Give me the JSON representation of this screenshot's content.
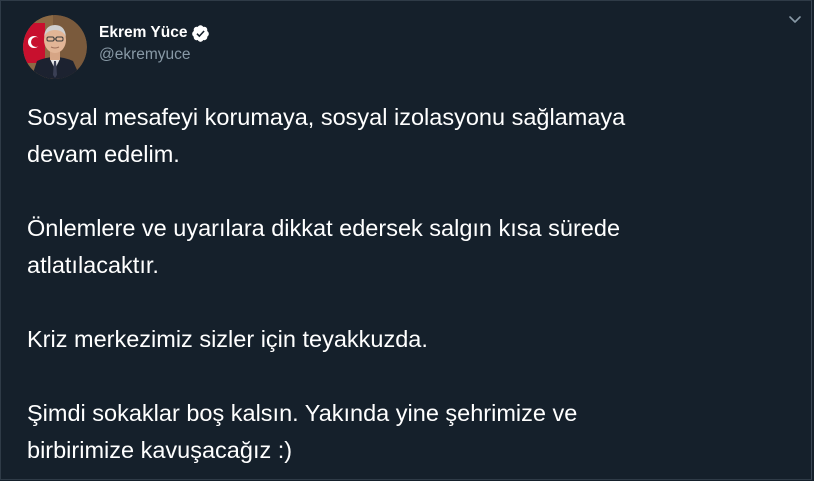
{
  "tweet": {
    "author": {
      "name": "Ekrem Yüce",
      "handle": "@ekremyuce",
      "verified": true
    },
    "paragraphs": [
      [
        "Sosyal mesafeyi korumaya, sosyal izolasyonu sağlamaya",
        "devam edelim."
      ],
      [
        "Önlemlere ve uyarılara dikkat edersek salgın kısa sürede",
        "atlatılacaktır."
      ],
      [
        "Kriz merkezimiz sizler için teyakkuzda."
      ],
      [
        "Şimdi sokaklar boş kalsın. Yakında yine şehrimize ve",
        "birbirimize kavuşacağız :)"
      ]
    ]
  },
  "icons": {
    "verified": "verified-badge-icon",
    "menu": "chevron-down-icon"
  },
  "colors": {
    "background": "#15202b",
    "text": "#ffffff",
    "secondary_text": "#8899a6",
    "border": "#2f3b47"
  }
}
